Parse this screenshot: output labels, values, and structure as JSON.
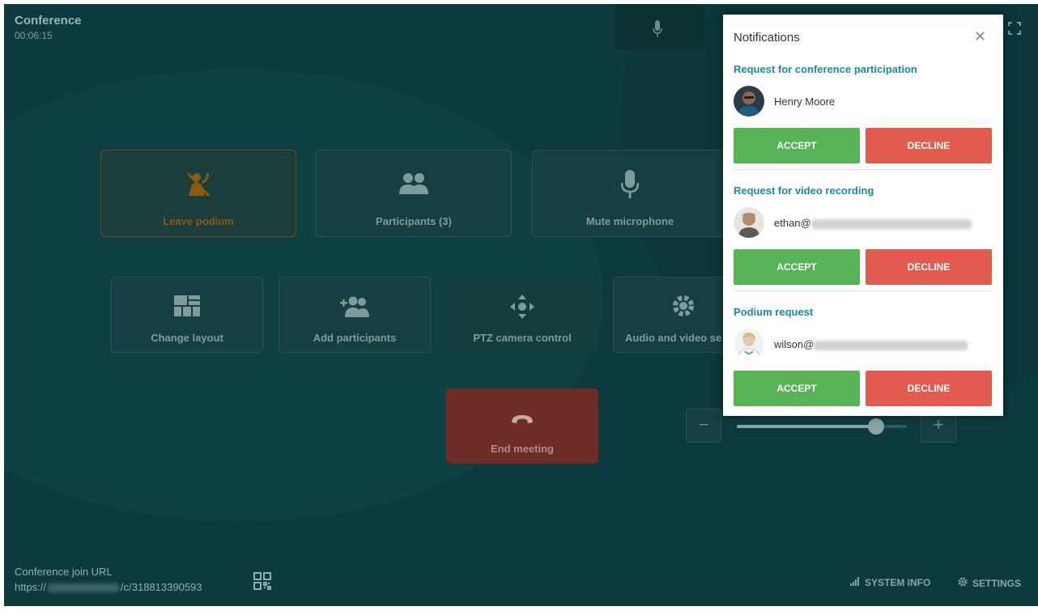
{
  "conference": {
    "title": "Conference",
    "elapsed": "00:06:15"
  },
  "tiles": {
    "leave_podium": "Leave podium",
    "participants": "Participants (3)",
    "mute_microphone": "Mute microphone",
    "change_layout": "Change layout",
    "add_participants": "Add participants",
    "ptz_camera_control": "PTZ camera control",
    "audio_video_settings": "Audio and video se",
    "end_meeting": "End meeting"
  },
  "zoom": {
    "minus": "−",
    "plus": "+",
    "level": 0.82
  },
  "footer": {
    "join_label": "Conference join URL",
    "join_url_prefix": "https://",
    "join_url_suffix": "/c/318813390593",
    "system_info": "SYSTEM INFO",
    "settings": "SETTINGS"
  },
  "notifications": {
    "title": "Notifications",
    "close": "✕",
    "requests": [
      {
        "title": "Request for conference participation",
        "user": "Henry Moore",
        "accept": "ACCEPT",
        "decline": "DECLINE"
      },
      {
        "title": "Request for video recording",
        "user": "ethan@",
        "accept": "ACCEPT",
        "decline": "DECLINE"
      },
      {
        "title": "Podium request",
        "user": "wilson@",
        "accept": "ACCEPT",
        "decline": "DECLINE"
      }
    ]
  },
  "colors": {
    "accept": "#58b358",
    "decline": "#e15b4e",
    "accent": "#1b8aa6",
    "background": "#0c3a3e"
  }
}
